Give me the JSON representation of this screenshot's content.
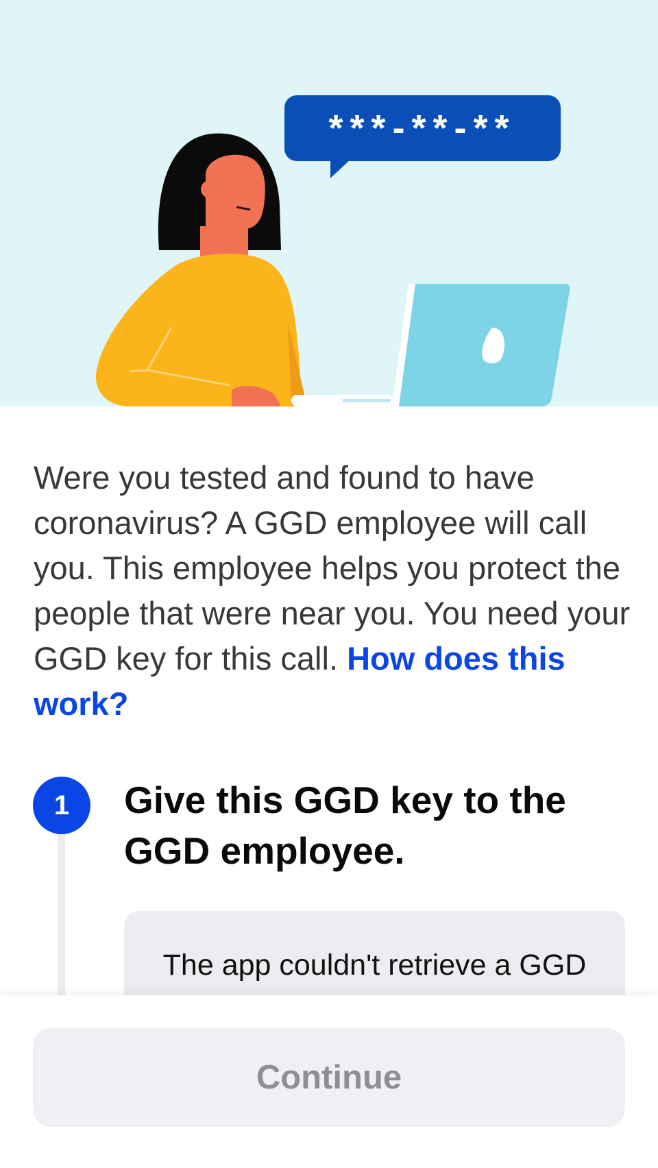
{
  "hero": {
    "speech_bubble_text": "***-**-**",
    "colors": {
      "background": "#e0f5f8",
      "bubble": "#0a4fb8",
      "shirt": "#fbb41a",
      "skin": "#f27256",
      "laptop": "#7dd4e6"
    }
  },
  "intro": {
    "text": "Were you tested and found to have coronavirus? A GGD employee will call you. This employee helps you protect the people that were near you. You need your GGD key for this call.",
    "link_label": "How does this work?"
  },
  "step": {
    "number": "1",
    "title": "Give this GGD key to the GGD employee.",
    "card_text": "The app couldn't retrieve a GGD key. Please check"
  },
  "footer": {
    "continue_label": "Continue"
  },
  "colors": {
    "accent": "#0a46e6",
    "button_bg": "#efeff4",
    "button_text": "#8e8e93"
  }
}
